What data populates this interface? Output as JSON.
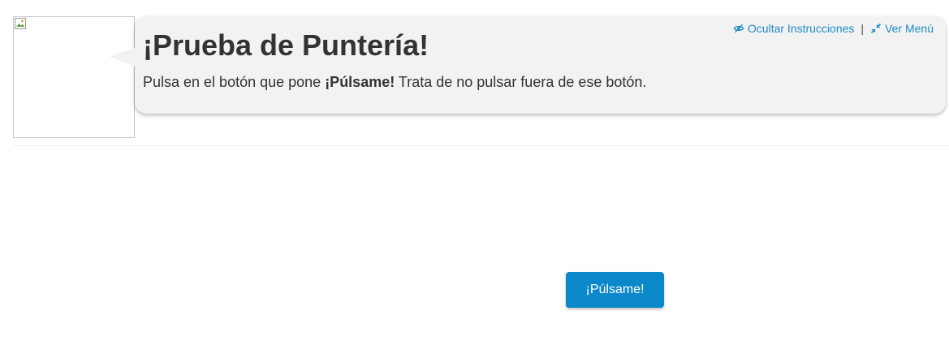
{
  "header": {
    "title": "¡Prueba de Puntería!",
    "instructions_before": "Pulsa en el botón que pone ",
    "instructions_bold": "¡Púlsame!",
    "instructions_after": " Trata de no pulsar fuera de ese botón."
  },
  "links": {
    "hide_instructions": "Ocultar Instrucciones",
    "separator": "|",
    "show_menu": "Ver Menú"
  },
  "icons": {
    "hide": "eye-slash-icon",
    "menu": "compress-icon",
    "avatar": "broken-image-icon"
  },
  "main": {
    "button_label": "¡Púlsame!"
  },
  "colors": {
    "accent": "#0a88c9",
    "link": "#1f8ac6",
    "bubble": "#f2f2f2",
    "text": "#333333"
  }
}
